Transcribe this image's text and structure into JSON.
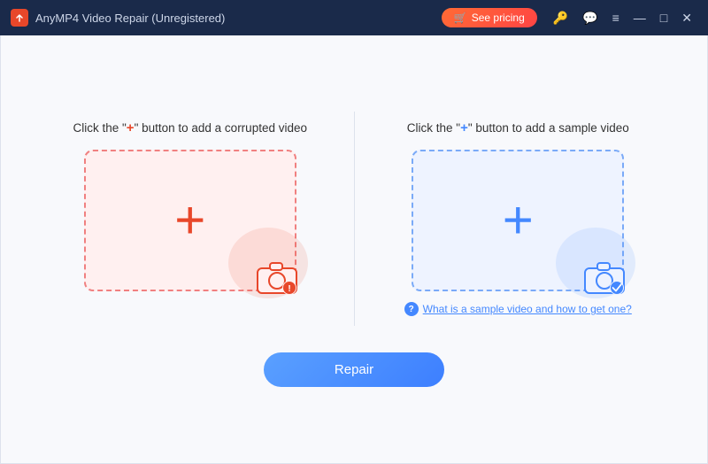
{
  "titlebar": {
    "app_icon_label": "A",
    "title": "AnyMP4 Video Repair (Unregistered)",
    "pricing_btn": "See pricing",
    "pricing_icon": "🛒",
    "window_controls": {
      "minimize": "—",
      "maximize": "□",
      "close": "✕"
    }
  },
  "icons": {
    "key": "🔑",
    "chat": "💬",
    "menu": "≡",
    "cart": "🛒"
  },
  "left_panel": {
    "label_prefix": "Click the \"",
    "label_plus": "+",
    "label_suffix": "\" button to add a corrupted video",
    "color": "red"
  },
  "right_panel": {
    "label_prefix": "Click the \"",
    "label_plus": "+",
    "label_suffix": "\" button to add a sample video",
    "color": "blue",
    "help_text": "What is a sample video and how to get one?"
  },
  "repair_button": {
    "label": "Repair"
  }
}
